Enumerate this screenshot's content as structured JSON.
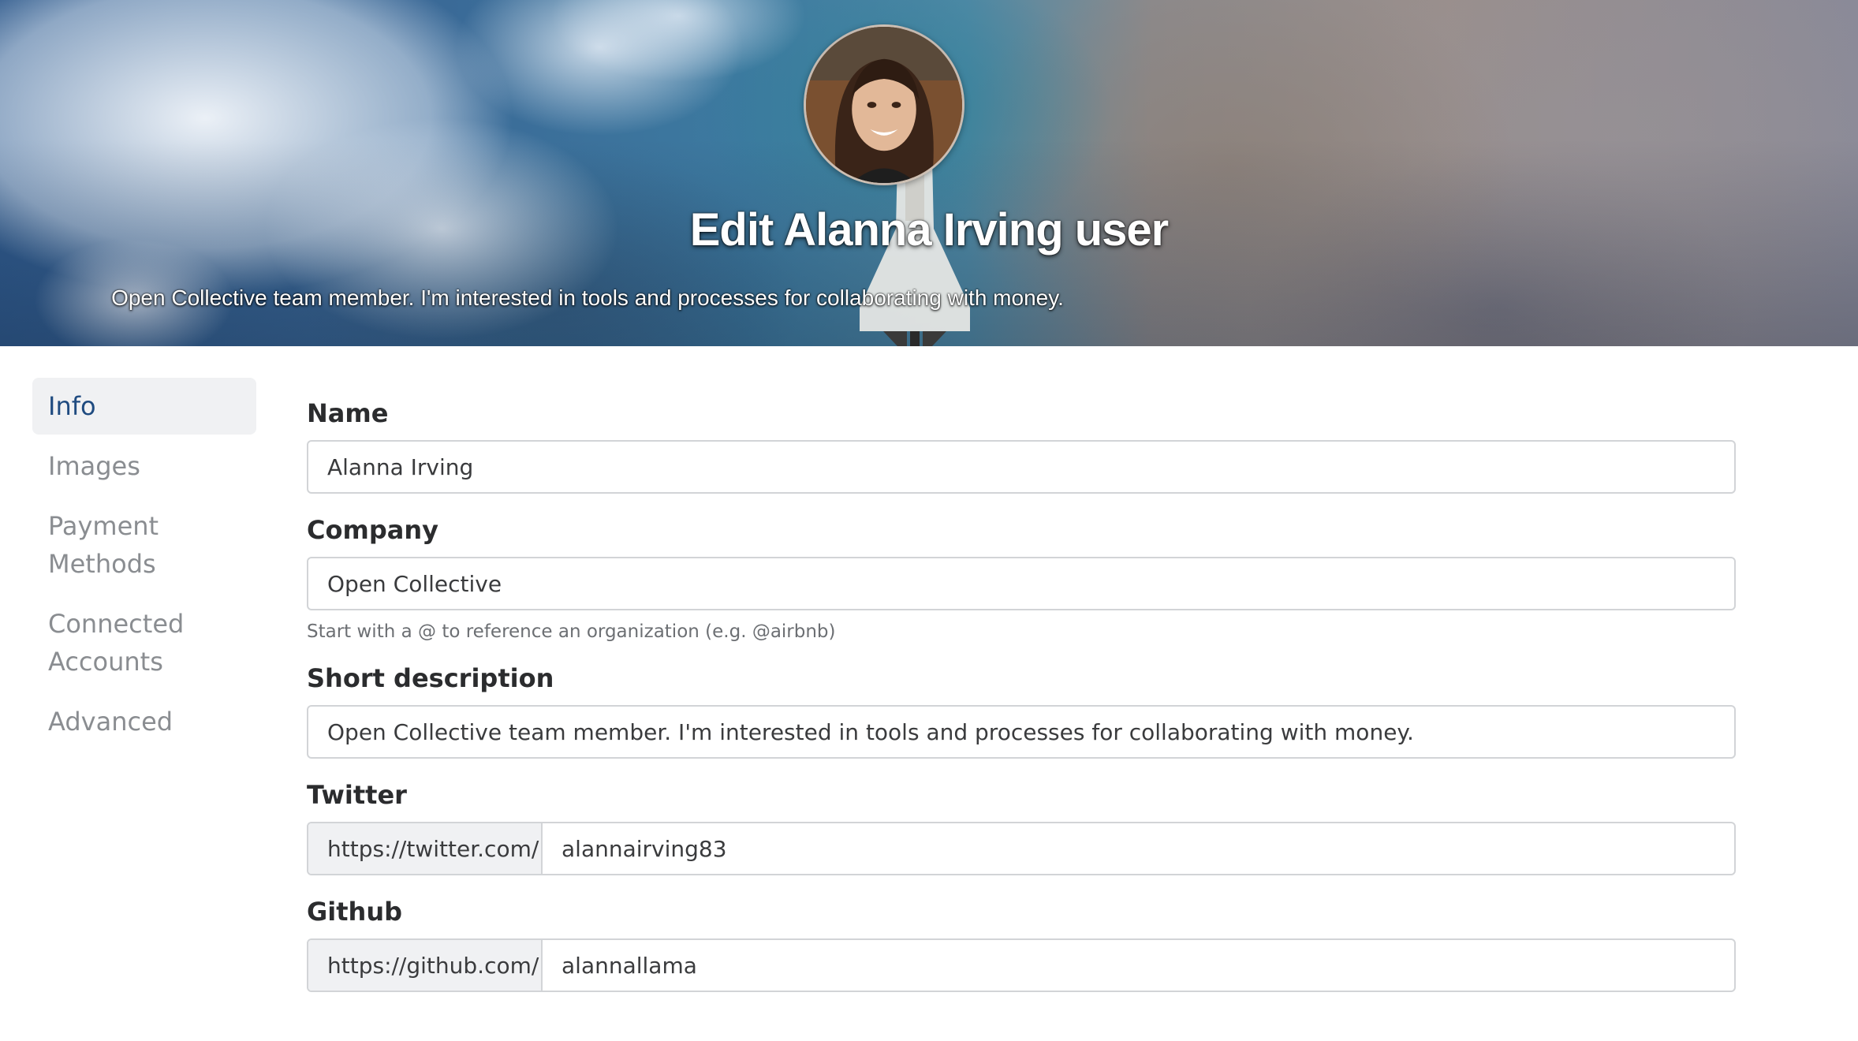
{
  "header": {
    "title": "Edit Alanna Irving user",
    "description": "Open Collective team member. I'm interested in tools and processes for collaborating with money."
  },
  "sidebar": {
    "items": [
      {
        "label": "Info",
        "active": true
      },
      {
        "label": "Images"
      },
      {
        "label": "Payment Methods"
      },
      {
        "label": "Connected Accounts"
      },
      {
        "label": "Advanced"
      }
    ]
  },
  "form": {
    "name": {
      "label": "Name",
      "value": "Alanna Irving"
    },
    "company": {
      "label": "Company",
      "value": "Open Collective",
      "hint": "Start with a @ to reference an organization (e.g. @airbnb)"
    },
    "short_description": {
      "label": "Short description",
      "value": "Open Collective team member. I'm interested in tools and processes for collaborating with money."
    },
    "twitter": {
      "label": "Twitter",
      "prefix": "https://twitter.com/",
      "value": "alannairving83"
    },
    "github": {
      "label": "Github",
      "prefix": "https://github.com/",
      "value": "alannallama"
    }
  },
  "colors": {
    "active_nav_text": "#1f4b80",
    "active_nav_bg": "#f0f1f3",
    "inactive_nav_text": "#8a8d91",
    "input_border": "#d2d4d7"
  }
}
